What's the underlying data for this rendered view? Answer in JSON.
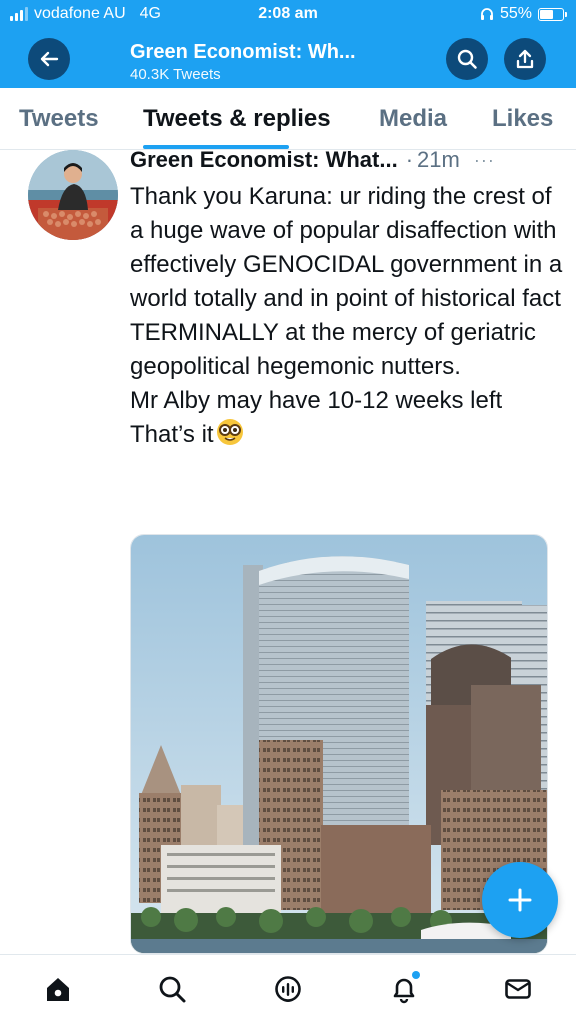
{
  "status_bar": {
    "carrier": "vodafone AU",
    "network": "4G",
    "time": "2:08 am",
    "battery": "55%"
  },
  "header": {
    "title": "Green Economist: Wh...",
    "subtitle": "40.3K Tweets",
    "back_icon": "arrow-left-icon",
    "search_icon": "search-icon",
    "share_icon": "share-icon"
  },
  "tabs": [
    {
      "label": "Tweets"
    },
    {
      "label": "Tweets & replies"
    },
    {
      "label": "Media"
    },
    {
      "label": "Likes"
    }
  ],
  "active_tab": "Tweets & replies",
  "tweet": {
    "author": "Green Economist: What...",
    "separator": "·",
    "time": "21m",
    "more": "···",
    "text": "Thank you Karuna: ur riding the crest of a huge wave of popular disaffection with effectively GENOCIDAL government in a world totally and in point of historical fact TERMINALLY at the mercy of geriatric geopolitical hegemonic nutters.",
    "text2": "Mr Alby may have 10-12 weeks left",
    "text3": "That’s it",
    "emoji": "nerd-face-emoji"
  },
  "fab": {
    "icon": "plus-icon"
  },
  "bottom_nav": [
    {
      "icon": "home-icon"
    },
    {
      "icon": "search-icon"
    },
    {
      "icon": "spaces-icon"
    },
    {
      "icon": "notifications-icon"
    },
    {
      "icon": "messages-icon"
    }
  ],
  "colors": {
    "accent": "#1da1f2",
    "header_button": "#0d4a7a",
    "text_primary": "#0f1419",
    "text_secondary": "#5b7083"
  }
}
